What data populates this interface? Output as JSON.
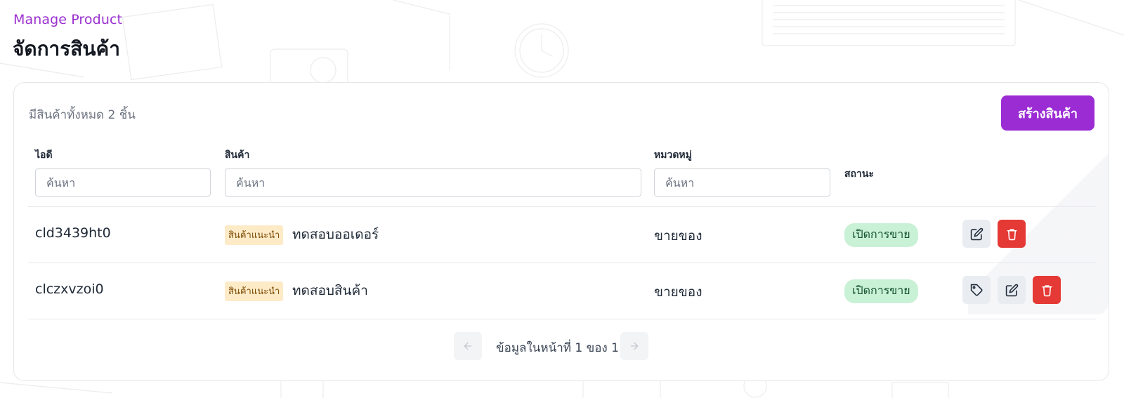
{
  "header": {
    "eyebrow": "Manage Product",
    "title": "จัดการสินค้า"
  },
  "toolbar": {
    "total_text": "มีสินค้าทั้งหมด 2 ชิ้น",
    "create_label": "สร้างสินค้า"
  },
  "columns": {
    "id": "ไอดี",
    "product": "สินค้า",
    "category": "หมวดหมู่",
    "status": "สถานะ"
  },
  "filters": {
    "id_placeholder": "ค้นหา",
    "product_placeholder": "ค้นหา",
    "category_placeholder": "ค้นหา"
  },
  "rows": [
    {
      "id": "cld3439ht0",
      "badge": "สินค้าแนะนำ",
      "name": "ทดสอบออเดอร์",
      "category": "ขายของ",
      "status": "เปิดการขาย",
      "actions": [
        "edit-icon",
        "trash-icon"
      ]
    },
    {
      "id": "clczxvzoi0",
      "badge": "สินค้าแนะนำ",
      "name": "ทดสอบสินค้า",
      "category": "ขายของ",
      "status": "เปิดการขาย",
      "actions": [
        "tag-icon",
        "edit-icon",
        "trash-icon"
      ]
    }
  ],
  "pagination": {
    "text": "ข้อมูลในหน้าที่ 1 ของ 1"
  },
  "colors": {
    "accent": "#9b2cd4",
    "danger": "#e53935",
    "status_bg": "#c9f1d6",
    "badge_bg": "#fdebc8"
  }
}
